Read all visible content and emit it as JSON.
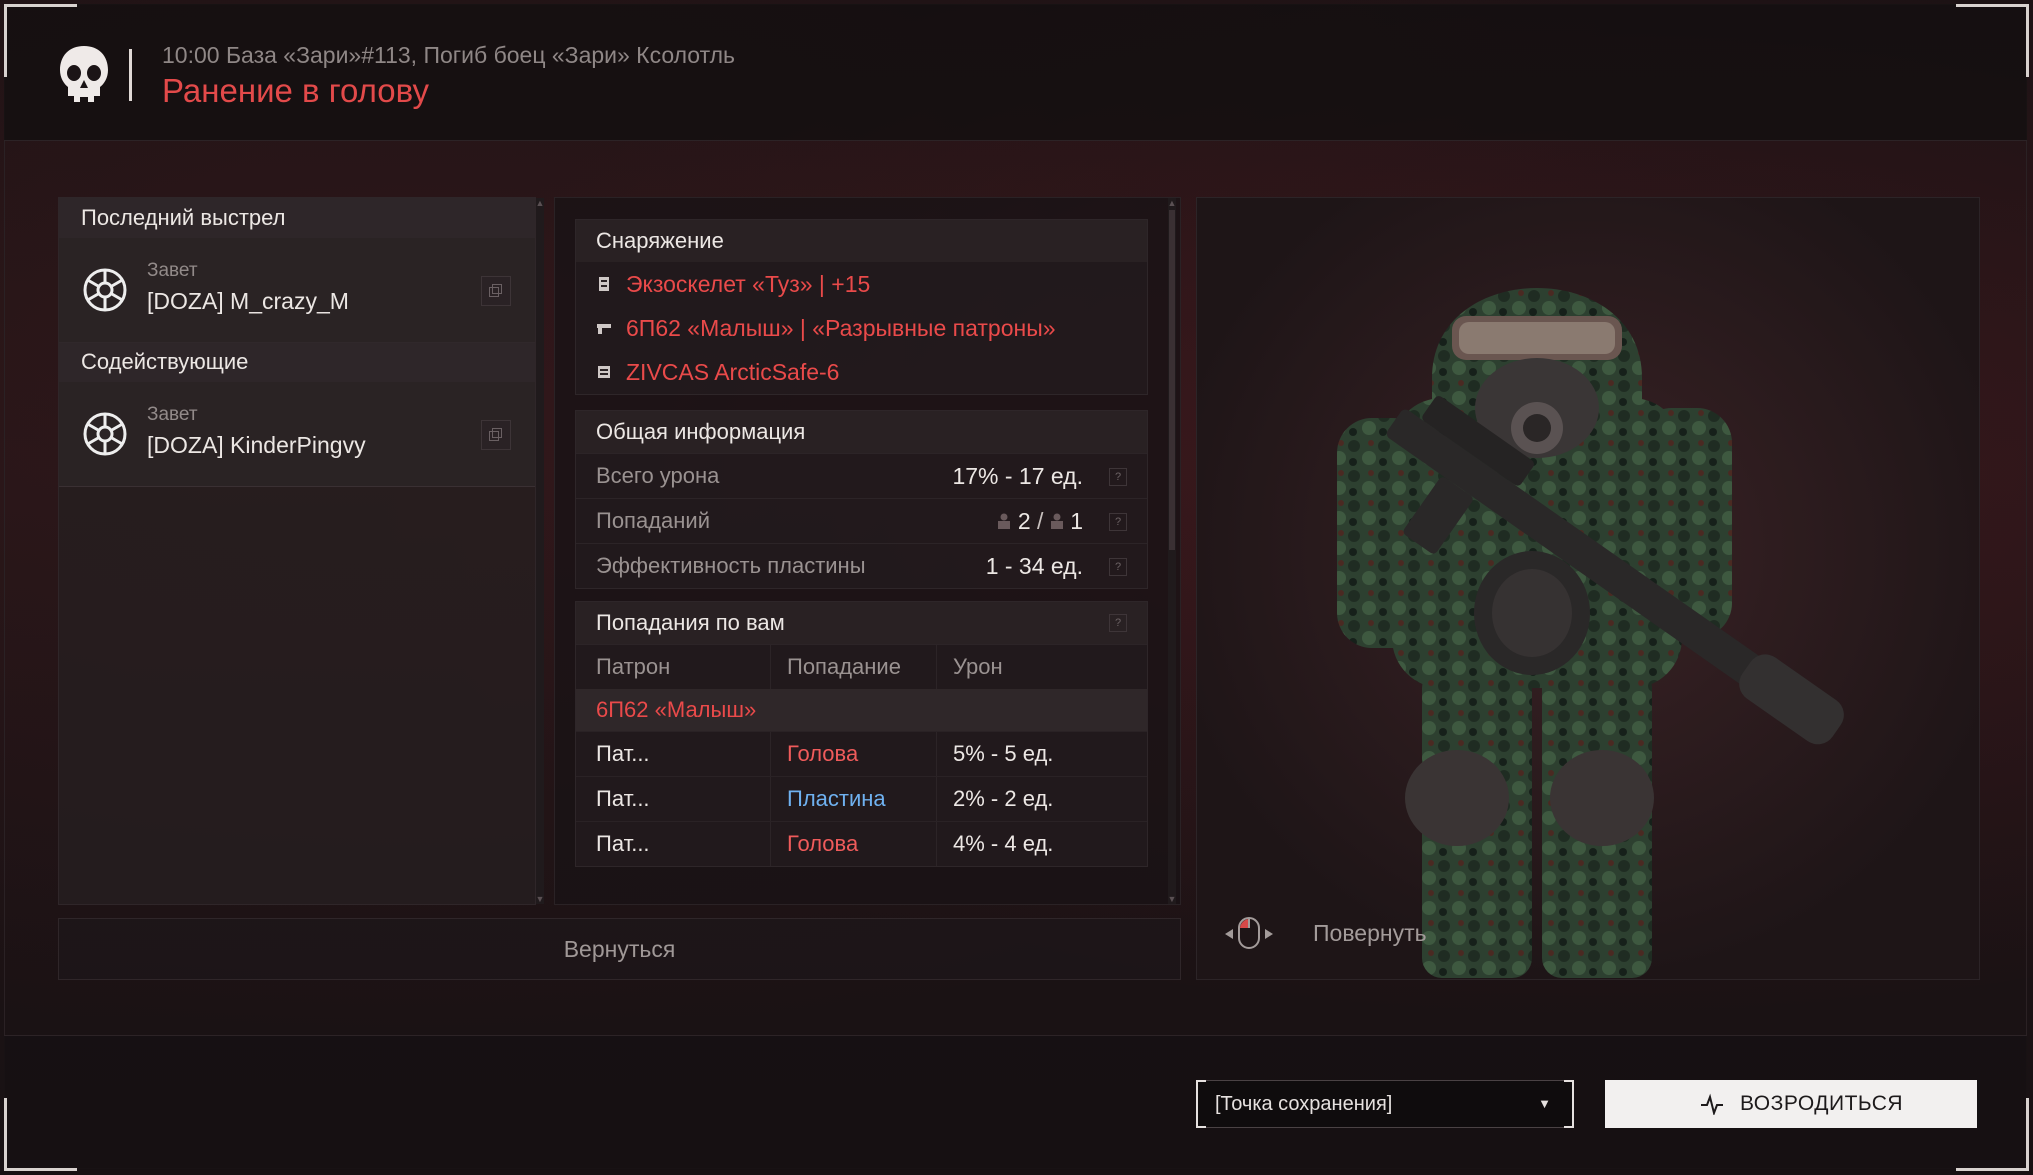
{
  "header": {
    "meta": "10:00 База «Зари»#113, Погиб боец «Зари» Ксолотль",
    "title": "Ранение в голову"
  },
  "left": {
    "last_shot_label": "Последний выстрел",
    "killer": {
      "faction": "Завет",
      "name": "[DOZA] M_crazy_M"
    },
    "assist_label": "Содействующие",
    "assistants": [
      {
        "faction": "Завет",
        "name": "[DOZA] KinderPingvy"
      }
    ]
  },
  "equipment": {
    "title": "Снаряжение",
    "items": [
      {
        "icon": "armor-icon",
        "text": "Экзоскелет «Туз» | +15"
      },
      {
        "icon": "gun-icon",
        "text": "6П62 «Малыш» | «Разрывные патроны»"
      },
      {
        "icon": "device-icon",
        "text": "ZIVCAS ArcticSafe-6"
      }
    ]
  },
  "general": {
    "title": "Общая информация",
    "rows": [
      {
        "label": "Всего урона",
        "value": "17% - 17 ед."
      },
      {
        "label": "Попаданий",
        "value_a": "2",
        "sep": "/",
        "value_b": "1"
      },
      {
        "label": "Эффективность пластины",
        "value": "1 - 34 ед."
      }
    ]
  },
  "hits": {
    "title": "Попадания по вам",
    "columns": [
      "Патрон",
      "Попадание",
      "Урон"
    ],
    "weapon": "6П62 «Малыш»",
    "rows": [
      {
        "ammo": "Пат...",
        "zone": "Голова",
        "damage": "5% - 5 ед."
      },
      {
        "ammo": "Пат...",
        "zone": "Пластина",
        "damage": "2% - 2 ед."
      },
      {
        "ammo": "Пат...",
        "zone": "Голова",
        "damage": "4% - 4 ед."
      }
    ]
  },
  "back_label": "Вернуться",
  "rotate_label": "Повернуть",
  "respawn": {
    "point": "[Точка сохранения]",
    "button": "ВОЗРОДИТЬСЯ"
  },
  "colors": {
    "accent_red": "#e34a4a",
    "plate_blue": "#6fb1f0"
  }
}
